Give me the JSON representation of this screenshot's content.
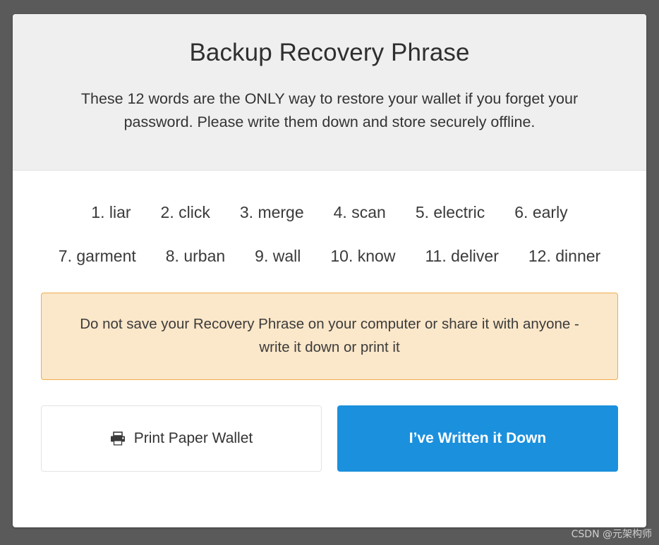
{
  "dialog": {
    "title": "Backup Recovery Phrase",
    "subtitle": "These 12 words are the ONLY way to restore your wallet if you forget your password. Please write them down and store securely offline."
  },
  "recovery_phrase": {
    "word_count": 12,
    "words": [
      {
        "index": "1.",
        "word": "liar"
      },
      {
        "index": "2.",
        "word": "click"
      },
      {
        "index": "3.",
        "word": "merge"
      },
      {
        "index": "4.",
        "word": "scan"
      },
      {
        "index": "5.",
        "word": "electric"
      },
      {
        "index": "6.",
        "word": "early"
      },
      {
        "index": "7.",
        "word": "garment"
      },
      {
        "index": "8.",
        "word": "urban"
      },
      {
        "index": "9.",
        "word": "wall"
      },
      {
        "index": "10.",
        "word": "know"
      },
      {
        "index": "11.",
        "word": "deliver"
      },
      {
        "index": "12.",
        "word": "dinner"
      }
    ]
  },
  "warning": {
    "text": "Do not save your Recovery Phrase on your computer or share it with anyone - write it down or print it",
    "background_color": "#fbe7c9",
    "border_color": "#f0ad4e"
  },
  "actions": {
    "print_label": "Print Paper Wallet",
    "print_icon": "printer-icon",
    "confirm_label": "I’ve Written it Down",
    "confirm_color": "#1b90dd"
  },
  "watermark": {
    "text": "CSDN @元架构师"
  }
}
